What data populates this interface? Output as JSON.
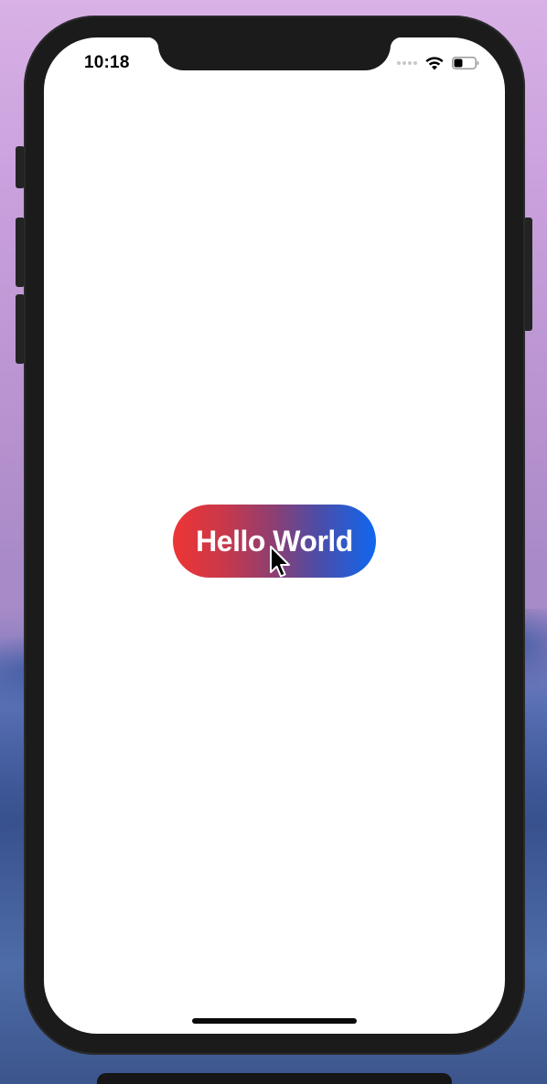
{
  "status_bar": {
    "time": "10:18",
    "wifi_icon": "wifi-icon",
    "battery_icon": "battery-icon",
    "signal_icon": "signal-dots-icon"
  },
  "main": {
    "button_label": "Hello World",
    "button_gradient": [
      "#ee3535",
      "#1067f0"
    ]
  },
  "colors": {
    "screen_background": "#ffffff",
    "device_frame": "#1b1b1b"
  }
}
